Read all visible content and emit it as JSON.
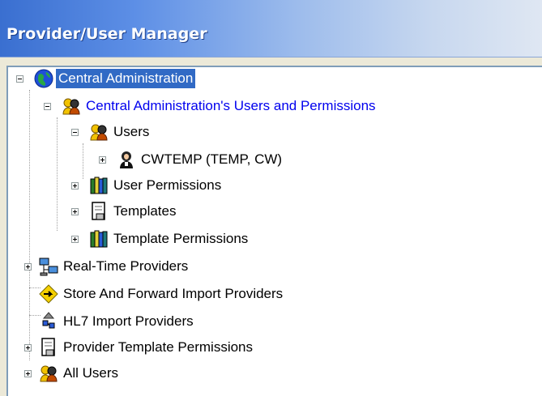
{
  "window": {
    "title": "Provider/User Manager"
  },
  "tree": {
    "root": {
      "label": "Central Administration",
      "icon": "globe-icon",
      "expanded": true,
      "selected": true
    },
    "items": [
      {
        "label": "Central Administration's Users and Permissions",
        "icon": "users-group-icon",
        "expanded": true
      },
      {
        "label": "Users",
        "icon": "users-group-icon",
        "expanded": true
      },
      {
        "label": "CWTEMP (TEMP, CW)",
        "icon": "user-icon",
        "expanded": false
      },
      {
        "label": "User Permissions",
        "icon": "books-icon",
        "expanded": false
      },
      {
        "label": "Templates",
        "icon": "document-icon",
        "expanded": false
      },
      {
        "label": "Template Permissions",
        "icon": "books-icon",
        "expanded": false
      },
      {
        "label": "Real-Time Providers",
        "icon": "network-computers-icon",
        "expanded": false
      },
      {
        "label": "Store And Forward Import Providers",
        "icon": "diamond-arrow-icon",
        "expanded": null
      },
      {
        "label": "HL7 Import Providers",
        "icon": "hl7-arrow-icon",
        "expanded": null
      },
      {
        "label": "Provider Template Permissions",
        "icon": "document-icon",
        "expanded": false
      },
      {
        "label": "All Users",
        "icon": "users-group-icon",
        "expanded": false
      }
    ]
  },
  "colors": {
    "selection": "#316ac5",
    "link": "#0000ee",
    "titlebar": "#3a6fd0"
  }
}
